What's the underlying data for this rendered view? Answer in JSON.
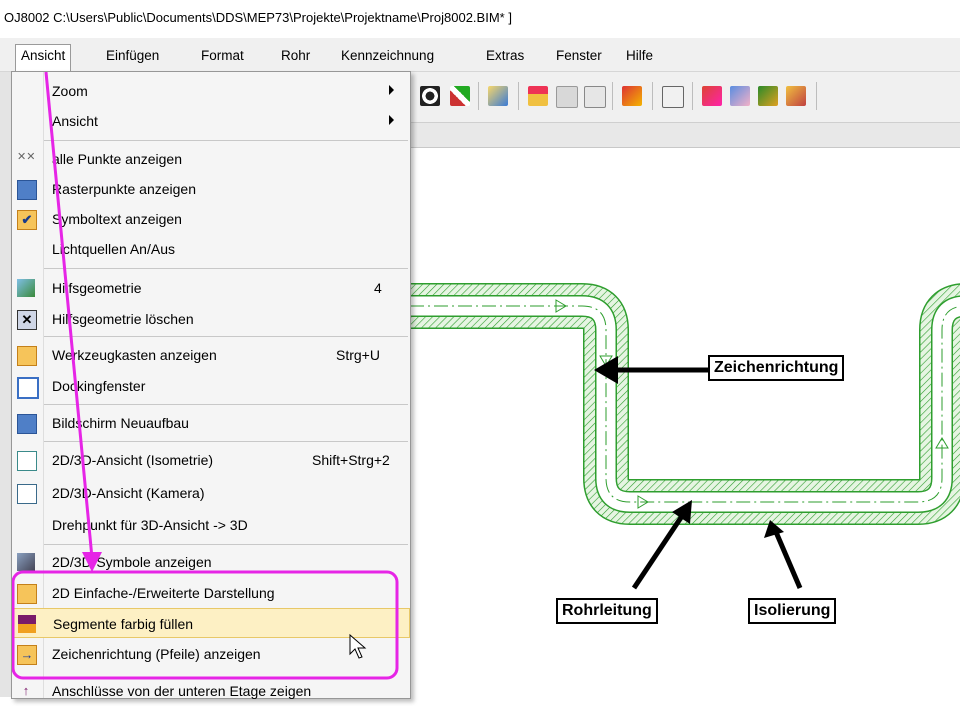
{
  "window": {
    "title": "OJ8002  C:\\Users\\Public\\Documents\\DDS\\MEP73\\Projekte\\Projektname\\Proj8002.BIM* ]"
  },
  "menubar": [
    "Ansicht",
    "Einfügen",
    "Format",
    "Rohr",
    "Kennzeichnung",
    "Extras",
    "Fenster",
    "Hilfe"
  ],
  "dropdown": {
    "items": [
      {
        "label": "Zoom",
        "submenu": true
      },
      {
        "label": "Ansicht",
        "submenu": true
      },
      {
        "label": "alle Punkte anzeigen",
        "icon": "points-icon"
      },
      {
        "label": "Rasterpunkte anzeigen",
        "icon": "grid-points-icon"
      },
      {
        "label": "Symboltext anzeigen",
        "icon": "checkmark-icon",
        "checked": true
      },
      {
        "label": "Lichtquellen An/Aus"
      },
      {
        "label": "Hilfsgeometrie",
        "shortcut": "4",
        "icon": "helper-geometry-icon"
      },
      {
        "label": "Hilfsgeometrie löschen",
        "icon": "delete-helper-geometry-icon"
      },
      {
        "label": "Werkzeugkasten anzeigen",
        "shortcut": "Strg+U",
        "icon": "toolbox-icon"
      },
      {
        "label": "Dockingfenster",
        "icon": "docking-window-icon"
      },
      {
        "label": "Bildschirm Neuaufbau",
        "icon": "screen-refresh-icon"
      },
      {
        "label": "2D/3D-Ansicht (Isometrie)",
        "shortcut": "Shift+Strg+2",
        "icon": "isometric-view-icon"
      },
      {
        "label": "2D/3D-Ansicht (Kamera)",
        "icon": "camera-view-icon"
      },
      {
        "label": "Drehpunkt für 3D-Ansicht -> 3D"
      },
      {
        "label": "2D/3D-Symbole anzeigen",
        "icon": "symbols-3d-icon"
      },
      {
        "label": "2D Einfache-/Erweiterte Darstellung",
        "icon": "simple-extended-icon"
      },
      {
        "label": "Segmente farbig füllen",
        "icon": "fill-segments-icon",
        "highlighted": true
      },
      {
        "label": "Zeichenrichtung (Pfeile) anzeigen",
        "icon": "arrow-direction-icon"
      },
      {
        "label": "Anschlüsse von der unteren Etage zeigen",
        "icon": "connections-icon"
      }
    ]
  },
  "annotations": {
    "zeichenrichtung": "Zeichenrichtung",
    "rohrleitung": "Rohrleitung",
    "isolierung": "Isolierung"
  },
  "colors": {
    "highlight_frame": "#e625e6",
    "pipe_green": "#2e9e2e",
    "pipe_fill": "#d7f0d2",
    "menu_highlight": "#fdf0c4"
  }
}
